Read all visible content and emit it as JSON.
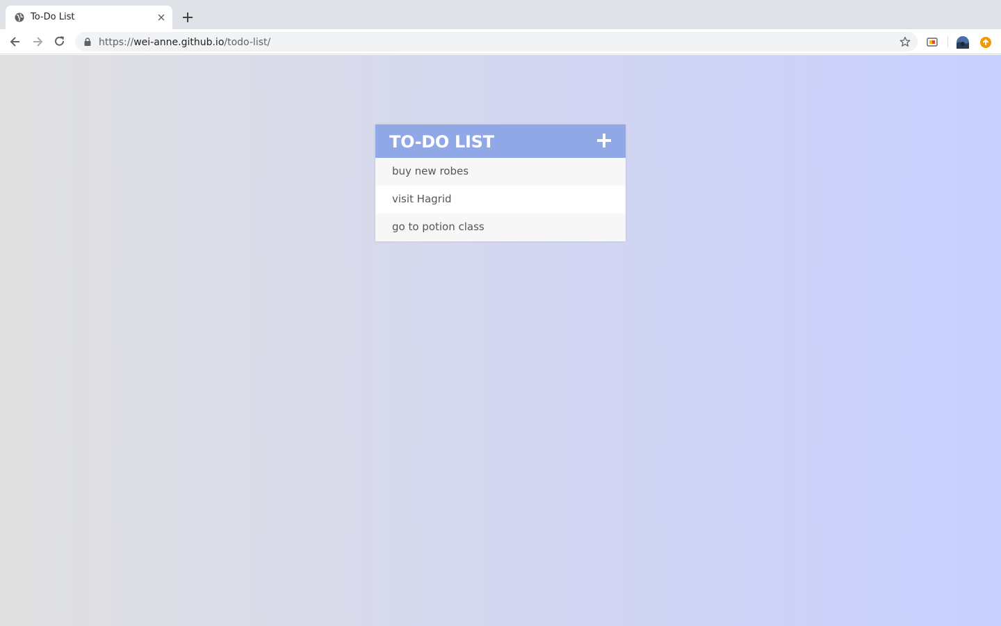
{
  "browser": {
    "tab": {
      "title": "To-Do List",
      "favicon": "globe-icon"
    },
    "address": {
      "scheme": "https://",
      "host": "wei-anne.github.io",
      "path": "/todo-list/"
    },
    "icons": [
      "back-icon",
      "forward-icon",
      "reload-icon",
      "lock-icon",
      "star-icon",
      "cast-icon",
      "profile-avatar",
      "update-icon"
    ]
  },
  "todo": {
    "title": "TO-DO LIST",
    "add_icon": "plus-icon",
    "items": [
      "buy new robes",
      "visit Hagrid",
      "go to potion class"
    ]
  },
  "colors": {
    "header": "#90a8e6",
    "item_odd": "#f7f7f7",
    "item_even": "#ffffff",
    "text": "#555555"
  }
}
